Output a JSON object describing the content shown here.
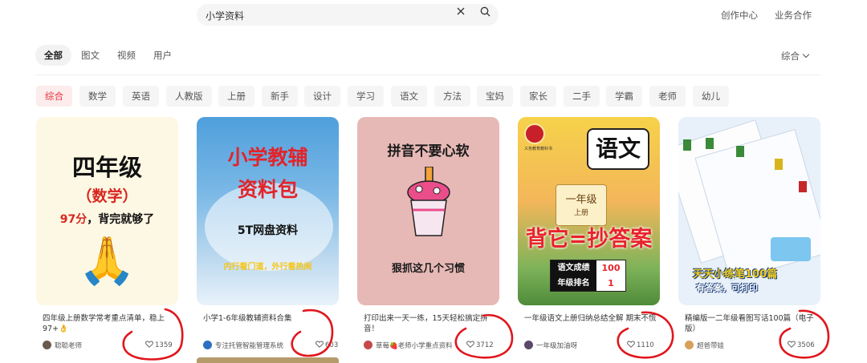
{
  "search": {
    "query": "小学资料"
  },
  "header_links": [
    "创作中心",
    "业务合作"
  ],
  "type_tabs": [
    "全部",
    "图文",
    "视频",
    "用户"
  ],
  "sort": {
    "label": "综合"
  },
  "chips": [
    "综合",
    "数学",
    "英语",
    "人教版",
    "上册",
    "新手",
    "设计",
    "学习",
    "语文",
    "方法",
    "宝妈",
    "家长",
    "二手",
    "学霸",
    "老师",
    "幼儿"
  ],
  "cards": [
    {
      "title": "四年级上册数学常考重点清单，稳上97+👌",
      "author": "聪聪老师",
      "likes": "1359",
      "cover": {
        "l1": "四年级",
        "l2": "（数学）",
        "l3a": "97分",
        "l3b": "，背完就够了",
        "emoji": "🙏"
      }
    },
    {
      "title": "小学1-6年级教辅资料合集",
      "author": "专注托管智能管理系统",
      "likes": "603",
      "cover": {
        "l1": "小学教辅",
        "l2": "资料包",
        "l3": "5T网盘资料",
        "l4": "内行看门道，外行看热闹"
      }
    },
    {
      "title": "打印出来一天一练，15天轻松搞定拼音！",
      "author": "草莓🍓老师小学重点资料",
      "likes": "3712",
      "cover": {
        "l1": "拼音不要心软",
        "l2": "狠抓这几个习惯"
      }
    },
    {
      "title": "一年级语文上册归纳总结全解 期末不慌",
      "author": "一年级加油呀",
      "likes": "1110",
      "cover": {
        "book": "语文",
        "grade": "一年级",
        "term": "上册",
        "slogan": "背它=抄答案",
        "row1_label": "语文成绩",
        "row1_value": "100",
        "row2_label": "年级排名",
        "row2_value": "1",
        "press": "义务教育教科书"
      }
    },
    {
      "title": "精编版一二年级看图写话100篇（电子版）",
      "author": "超爸带娃",
      "likes": "3506",
      "cover": {
        "l1": "天天小练笔100篇",
        "l2": "有答案，可打印"
      }
    }
  ],
  "colors": {
    "accent": "#e5303d",
    "chip_bg": "#f5f5f5",
    "annotation": "#e0161c"
  }
}
